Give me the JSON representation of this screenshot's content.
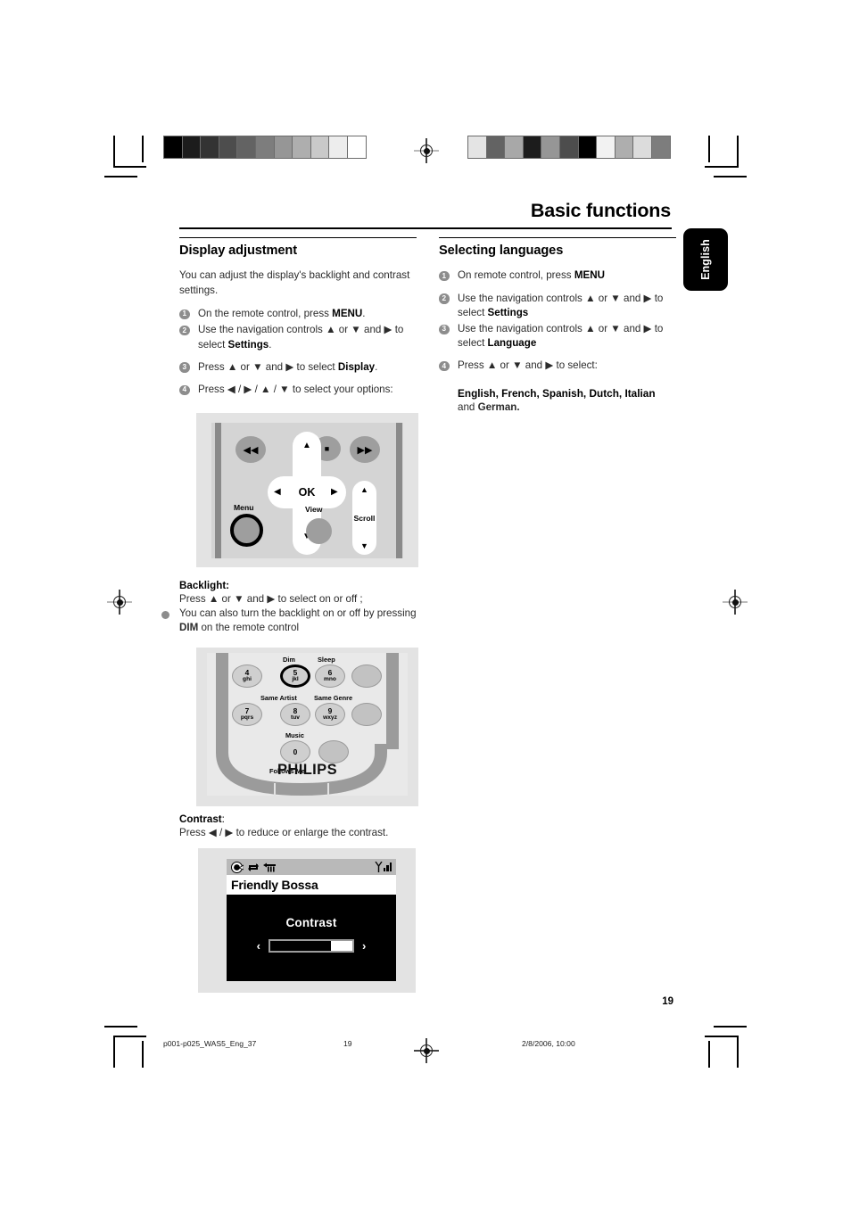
{
  "chapter": {
    "title": "Basic functions"
  },
  "lang_tab": {
    "label": "English"
  },
  "left": {
    "heading": "Display adjustment",
    "intro": "You can adjust the display's backlight and contrast settings.",
    "steps": [
      {
        "num": "1",
        "text": "On the remote control, press ",
        "bold": "MENU",
        "tail": "."
      },
      {
        "num": "2",
        "text": "Use the navigation controls ▲ or ▼ and ▶ to select ",
        "bold": "Settings",
        "tail": "."
      },
      {
        "num": "3",
        "text": "Press ▲ or ▼ and ▶ to  select ",
        "bold": "Display",
        "tail": "."
      },
      {
        "num": "4",
        "text": "Press ◀ / ▶ / ▲ / ▼ to  select  your options:",
        "bold": "",
        "tail": ""
      }
    ],
    "backlight": {
      "label": "Backlight:",
      "line1": "Press ▲ or ▼ and ▶ to select on or off ;",
      "bullet_pre": "You can also turn the backlight on or off by pressing ",
      "bullet_bold": "DIM",
      "bullet_post": " on the remote control"
    },
    "contrast": {
      "label": "Contrast",
      "label_suffix": ":",
      "line": "Press ◀ / ▶ to reduce or enlarge the contrast."
    }
  },
  "right": {
    "heading": "Selecting languages",
    "steps": [
      {
        "num": "1",
        "text": "On remote control, press ",
        "bold": "MENU",
        "tail": ""
      },
      {
        "num": "2",
        "text": "Use the navigation controls ▲ or ▼ and ▶ to select ",
        "bold": "Settings",
        "tail": ""
      },
      {
        "num": "3",
        "text": "Use the navigation controls ▲ or ▼ and ▶ to select ",
        "bold": "Language",
        "tail": ""
      },
      {
        "num": "4",
        "text": "Press ▲ or ▼ and ▶ to  select:",
        "bold": "",
        "tail": ""
      }
    ],
    "languages_bold": "English, French, Spanish, Dutch, Italian",
    "languages_tail_pre": "and ",
    "languages_tail_bold": "German."
  },
  "figure_navpad": {
    "buttons": {
      "rewind": "◀◀",
      "stop": "■",
      "forward": "▶▶",
      "ok": "OK",
      "up": "▲",
      "down": "▼",
      "left": "◀",
      "right": "▶"
    },
    "labels": {
      "menu": "Menu",
      "view": "View",
      "scroll": "Scroll"
    }
  },
  "figure_keypad": {
    "labels": {
      "dim": "Dim",
      "sleep": "Sleep",
      "same_artist": "Same Artist",
      "same_genre": "Same Genre",
      "music": "Music",
      "follows_me": "Follows Me"
    },
    "keys": [
      {
        "num": "4",
        "letters": "ghi"
      },
      {
        "num": "5",
        "letters": "jkl"
      },
      {
        "num": "6",
        "letters": "mno"
      },
      {
        "num": "7",
        "letters": "pqrs"
      },
      {
        "num": "8",
        "letters": "tuv"
      },
      {
        "num": "9",
        "letters": "wxyz"
      },
      {
        "num": "0",
        "letters": ""
      }
    ],
    "brand": "PHILIPS"
  },
  "figure_lcd": {
    "track_title": "Friendly Bossa",
    "menu_title": "Contrast",
    "chev_left": "‹",
    "chev_right": "›"
  },
  "footer": {
    "page_number": "19",
    "filename": "p001-p025_WAS5_Eng_37",
    "footer_page": "19",
    "timestamp": "2/8/2006, 10:00"
  },
  "calibration": {
    "left_bar": [
      "#000000",
      "#1c1c1c",
      "#333333",
      "#4d4d4d",
      "#636363",
      "#7d7d7d",
      "#969696",
      "#aeaeae",
      "#c9c9c9",
      "#ededed",
      "#ffffff"
    ],
    "right_bar": [
      "#e4e4e4",
      "#636363",
      "#a8a8a8",
      "#1c1c1c",
      "#969696",
      "#4d4d4d",
      "#000000",
      "#f2f2f2",
      "#aeaeae",
      "#dcdcdc",
      "#7d7d7d"
    ]
  }
}
